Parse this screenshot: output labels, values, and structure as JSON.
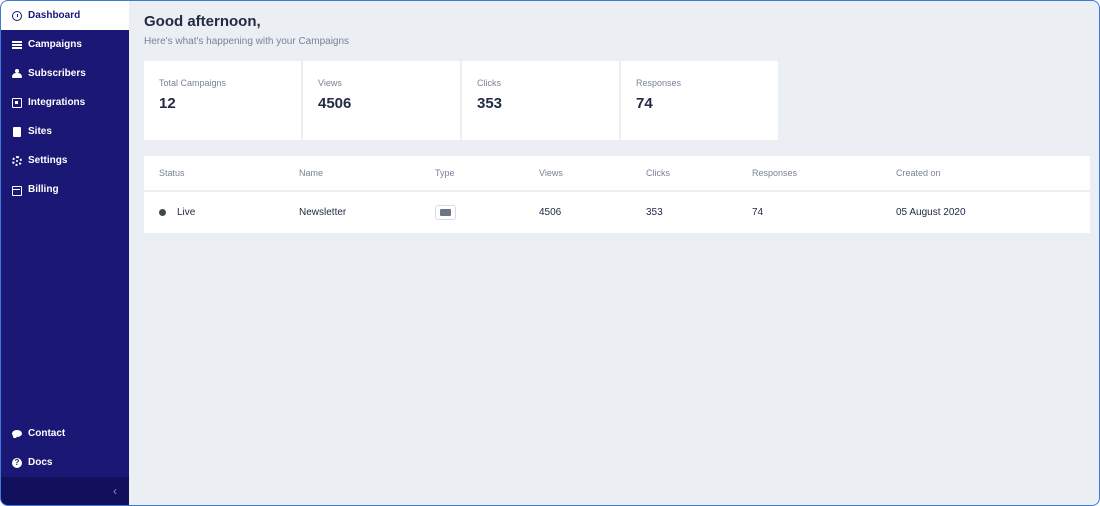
{
  "sidebar": {
    "items": [
      {
        "label": "Dashboard",
        "icon": "dashboard-icon"
      },
      {
        "label": "Campaigns",
        "icon": "list-icon"
      },
      {
        "label": "Subscribers",
        "icon": "users-icon"
      },
      {
        "label": "Integrations",
        "icon": "integrations-icon"
      },
      {
        "label": "Sites",
        "icon": "sites-icon"
      },
      {
        "label": "Settings",
        "icon": "gear-icon"
      },
      {
        "label": "Billing",
        "icon": "credit-card-icon"
      }
    ],
    "bottom_items": [
      {
        "label": "Contact",
        "icon": "chat-icon"
      },
      {
        "label": "Docs",
        "icon": "help-icon"
      }
    ],
    "collapse_glyph": "‹"
  },
  "header": {
    "greeting": "Good afternoon,",
    "subtitle": "Here's what's happening with your Campaigns"
  },
  "stats": [
    {
      "label": "Total Campaigns",
      "value": "12"
    },
    {
      "label": "Views",
      "value": "4506"
    },
    {
      "label": "Clicks",
      "value": "353"
    },
    {
      "label": "Responses",
      "value": "74"
    }
  ],
  "table": {
    "columns": [
      "Status",
      "Name",
      "Type",
      "Views",
      "Clicks",
      "Responses",
      "Created on"
    ],
    "rows": [
      {
        "status": "Live",
        "name": "Newsletter",
        "type_icon": "email-icon",
        "views": "4506",
        "clicks": "353",
        "responses": "74",
        "created_on": "05 August 2020"
      }
    ]
  },
  "colors": {
    "sidebar_bg": "#1a1775",
    "page_bg": "#ebeef3",
    "status_live": "#3f4a43"
  }
}
